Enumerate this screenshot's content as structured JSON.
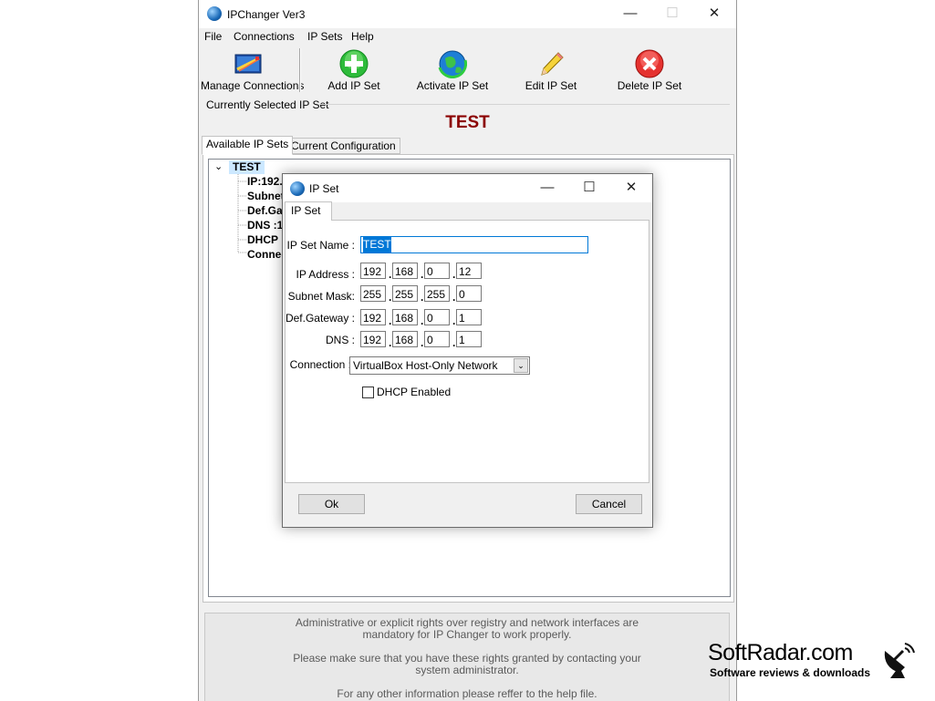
{
  "app": {
    "title": "IPChanger Ver3",
    "menu": [
      "File",
      "Connections",
      "IP Sets",
      "Help"
    ],
    "toolbar": {
      "manage": "Manage Connections",
      "add": "Add IP Set",
      "activate": "Activate IP Set",
      "edit": "Edit IP Set",
      "delete": "Delete IP Set"
    },
    "current_label": "Currently Selected IP Set",
    "current_value": "TEST",
    "tabs": [
      "Available IP Sets",
      "Current Configuration"
    ],
    "tree": {
      "root": "TEST",
      "children": [
        "IP:192.",
        "Subnet",
        "Def.Ga",
        "DNS :1",
        "DHCP :",
        "Connec"
      ]
    },
    "info": [
      "Administrative or explicit rights over registry and network interfaces are",
      "mandatory for IP Changer to work properly.",
      "Please make sure that you have these rights granted by contacting your",
      "system administrator.",
      "For any other information please reffer to the help file."
    ]
  },
  "dialog": {
    "title": "IP Set",
    "tab": "IP Set",
    "name_label": "IP Set Name :",
    "name_value": "TEST",
    "ip_label": "IP Address :",
    "ip": [
      "192",
      "168",
      "0",
      "12"
    ],
    "mask_label": "Subnet Mask:",
    "mask": [
      "255",
      "255",
      "255",
      "0"
    ],
    "gw_label": "Def.Gateway :",
    "gw": [
      "192",
      "168",
      "0",
      "1"
    ],
    "dns_label": "DNS :",
    "dns": [
      "192",
      "168",
      "0",
      "1"
    ],
    "conn_label": "Connection :",
    "conn_value": "VirtualBox Host-Only Network",
    "dhcp_label": "DHCP Enabled",
    "dhcp_checked": false,
    "ok": "Ok",
    "cancel": "Cancel"
  },
  "watermark": {
    "brand": "SoftRadar.com",
    "tagline": "Software reviews & downloads"
  },
  "colors": {
    "current_value": "#8b0000",
    "selection": "#0078d7",
    "tree_root_bg": "#cce8ff"
  }
}
